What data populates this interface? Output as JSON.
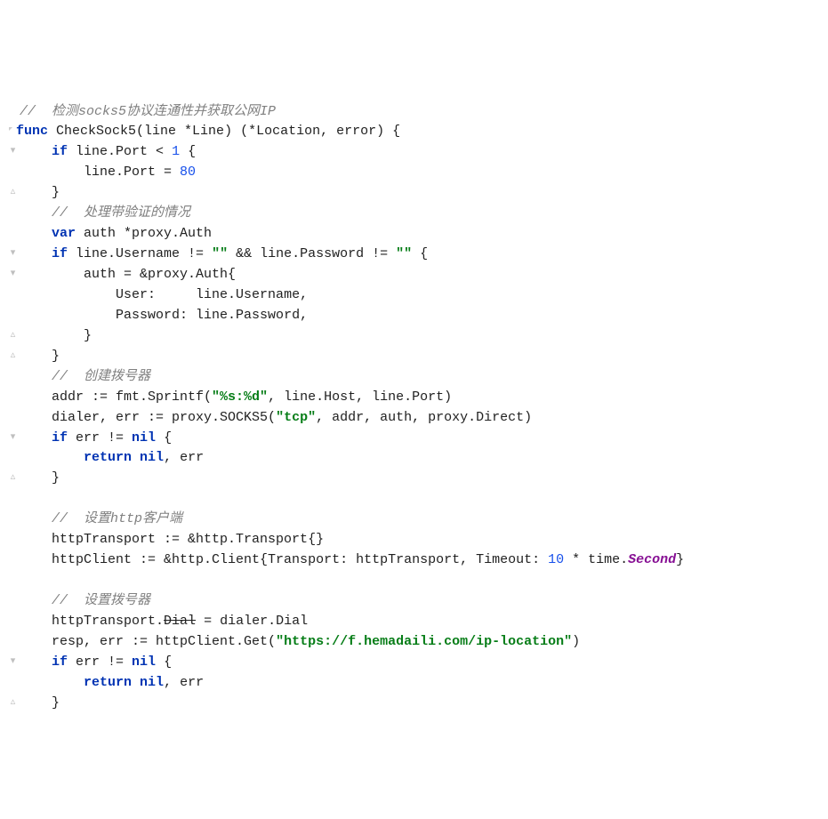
{
  "code": {
    "l1_comment": "//  检测socks5协议连通性并获取公网IP",
    "l2_kw_func": "func",
    "l2_name": "CheckSock5",
    "l2_sig_after": "(line *Line) (*Location, error) {",
    "l3_kw_if": "if",
    "l3_cond": " line.Port < ",
    "l3_num1": "1",
    "l3_brace": " {",
    "l4_assign": "line.Port = ",
    "l4_num80": "80",
    "l5_brace": "}",
    "l6_comment": "//  处理带验证的情况",
    "l7_kw_var": "var",
    "l7_decl": " auth *proxy.Auth",
    "l8_kw_if": "if",
    "l8_cond1": " line.Username != ",
    "l8_str_empty1": "\"\"",
    "l8_and": " && ",
    "l8_cond2": "line.Password != ",
    "l8_str_empty2": "\"\"",
    "l8_brace": " {",
    "l9_line": "auth = &proxy.Auth{",
    "l10_label": "User:     ",
    "l10_val": "line.Username,",
    "l11_label": "Password: ",
    "l11_val": "line.Password,",
    "l12_brace": "}",
    "l13_brace": "}",
    "l14_comment": "//  创建拨号器",
    "l15_assign": "addr := fmt.Sprintf(",
    "l15_str": "\"%s:%d\"",
    "l15_rest": ", line.Host, line.Port)",
    "l16_assign": "dialer, err := proxy.SOCKS5(",
    "l16_str": "\"tcp\"",
    "l16_rest": ", addr, auth, proxy.Direct)",
    "l17_kw_if": "if",
    "l17_cond": " err != ",
    "l17_kw_nil": "nil",
    "l17_brace": " {",
    "l18_kw_return": "return",
    "l18_rest": " ",
    "l18_kw_nil": "nil",
    "l18_rest2": ", err",
    "l19_brace": "}",
    "l21_comment": "//  设置http客户端",
    "l22_line": "httpTransport := &http.Transport{}",
    "l23_pre": "httpClient := &http.Client{Transport: httpTransport, Timeout: ",
    "l23_num": "10",
    "l23_mid": " * time.",
    "l23_second": "Second",
    "l23_end": "}",
    "l25_comment": "//  设置拨号器",
    "l26_pre": "httpTransport.",
    "l26_dial": "Dial",
    "l26_post": " = dialer.Dial",
    "l27_pre": "resp, err := httpClient.Get(",
    "l27_str": "\"https://f.hemadaili.com/ip-location\"",
    "l27_post": ")",
    "l28_kw_if": "if",
    "l28_cond": " err != ",
    "l28_kw_nil": "nil",
    "l28_brace": " {",
    "l29_kw_return": "return",
    "l29_mid": " ",
    "l29_kw_nil": "nil",
    "l29_rest": ", err",
    "l30_brace": "}"
  }
}
